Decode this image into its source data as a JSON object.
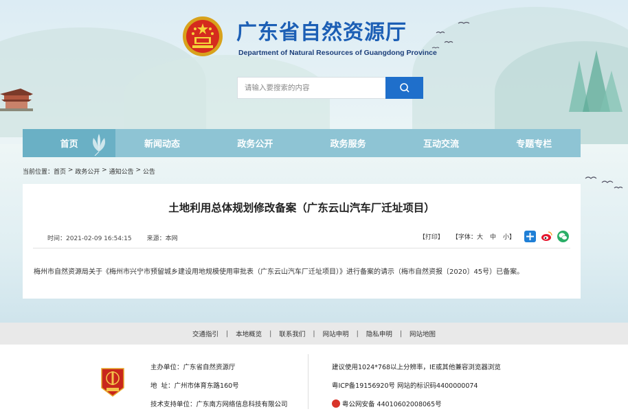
{
  "header": {
    "title": "广东省自然资源厅",
    "subtitle": "Department of Natural Resources of Guangdong Province"
  },
  "search": {
    "placeholder": "请输入要搜索的内容"
  },
  "nav": {
    "items": [
      {
        "label": "首页"
      },
      {
        "label": "新闻动态"
      },
      {
        "label": "政务公开"
      },
      {
        "label": "政务服务"
      },
      {
        "label": "互动交流"
      },
      {
        "label": "专题专栏"
      }
    ]
  },
  "breadcrumb": {
    "prefix": "当前位置：",
    "items": [
      "首页",
      "政务公开",
      "通知公告",
      "公告"
    ],
    "separator": " > "
  },
  "article": {
    "title": "土地利用总体规划修改备案（广东云山汽车厂迁址项目）",
    "time": "时间：2021-02-09 16:54:15",
    "source": "来源：本网",
    "print": "【打印】",
    "font_label": "【字体：",
    "font_large": "大",
    "font_medium": "中",
    "font_small": "小",
    "font_close": "】",
    "body": "梅州市自然资源局关于《梅州市兴宁市预留城乡建设用地规模使用审批表（广东云山汽车厂迁址项目）》进行备案的请示（梅市自然资报〔2020〕45号）已备案。"
  },
  "share": {
    "colors": {
      "share": "#1f7fd6",
      "weibo": "#e6162d",
      "wechat": "#2aae67"
    }
  },
  "footer_links": [
    "交通指引",
    "本地概览",
    "联系我们",
    "网站申明",
    "隐私申明",
    "网站地图"
  ],
  "footer": {
    "host": "主办单位：广东省自然资源厅",
    "address": "地  址：广州市体育东路160号",
    "support": "技术支持单位：广东南方网络信息科技有限公司",
    "browser": "建议使用1024*768以上分辨率，IE或其他兼容浏览器浏览",
    "icp": "粤ICP备19156920号 网站的标识码4400000074",
    "police": "粤公网安备 44010602008065号"
  },
  "colors": {
    "brand": "#1c5fb5",
    "nav_bg": "#8ec4d4",
    "nav_active": "#6ab0c5",
    "search_button": "#1f6fcb"
  }
}
